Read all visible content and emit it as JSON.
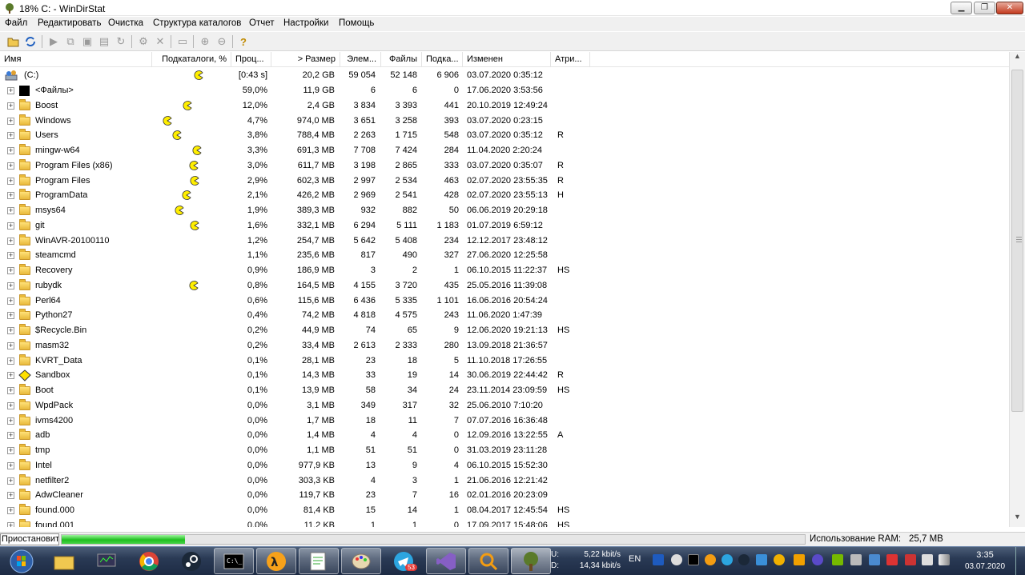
{
  "window": {
    "title": "18% C: - WinDirStat",
    "minimize_icon": "minimize-icon",
    "restore_icon": "restore-icon",
    "close_icon": "close-icon"
  },
  "menu": [
    "Файл",
    "Редактировать",
    "Очистка",
    "Структура каталогов",
    "Отчет",
    "Настройки",
    "Помощь"
  ],
  "toolbar": [
    "open-icon",
    "refresh-icon",
    "play-icon",
    "copy-icon",
    "explorer-icon",
    "cmd-icon",
    "refresh-selected-icon",
    "clean-icon",
    "delete-icon",
    "new-folder-icon",
    "zoom-in-icon",
    "zoom-out-icon",
    "help-icon"
  ],
  "columns": [
    "Имя",
    "Подкаталоги, %",
    "Проц...",
    "> Размер",
    "Элем...",
    "Файлы",
    "Подка...",
    "Изменен",
    "Атри..."
  ],
  "root": {
    "name": "(C:)",
    "percent": "[0:43 s]",
    "size": "20,2 GB",
    "items": "59 054",
    "files": "52 148",
    "subdirs": "6 906",
    "modified": "03.07.2020 0:35:12",
    "attr": ""
  },
  "rows": [
    {
      "name": "<Файлы>",
      "percent": "59,0%",
      "size": "11,9 GB",
      "items": "6",
      "files": "6",
      "subdirs": "0",
      "modified": "17.06.2020 3:53:56",
      "attr": ""
    },
    {
      "name": "Boost",
      "percent": "12,0%",
      "size": "2,4 GB",
      "items": "3 834",
      "files": "3 393",
      "subdirs": "441",
      "modified": "20.10.2019 12:49:24",
      "attr": ""
    },
    {
      "name": "Windows",
      "percent": "4,7%",
      "size": "974,0 MB",
      "items": "3 651",
      "files": "3 258",
      "subdirs": "393",
      "modified": "03.07.2020 0:23:15",
      "attr": ""
    },
    {
      "name": "Users",
      "percent": "3,8%",
      "size": "788,4 MB",
      "items": "2 263",
      "files": "1 715",
      "subdirs": "548",
      "modified": "03.07.2020 0:35:12",
      "attr": "R"
    },
    {
      "name": "mingw-w64",
      "percent": "3,3%",
      "size": "691,3 MB",
      "items": "7 708",
      "files": "7 424",
      "subdirs": "284",
      "modified": "11.04.2020 2:20:24",
      "attr": ""
    },
    {
      "name": "Program Files (x86)",
      "percent": "3,0%",
      "size": "611,7 MB",
      "items": "3 198",
      "files": "2 865",
      "subdirs": "333",
      "modified": "03.07.2020 0:35:07",
      "attr": "R"
    },
    {
      "name": "Program Files",
      "percent": "2,9%",
      "size": "602,3 MB",
      "items": "2 997",
      "files": "2 534",
      "subdirs": "463",
      "modified": "02.07.2020 23:55:35",
      "attr": "R"
    },
    {
      "name": "ProgramData",
      "percent": "2,1%",
      "size": "426,2 MB",
      "items": "2 969",
      "files": "2 541",
      "subdirs": "428",
      "modified": "02.07.2020 23:55:13",
      "attr": "H"
    },
    {
      "name": "msys64",
      "percent": "1,9%",
      "size": "389,3 MB",
      "items": "932",
      "files": "882",
      "subdirs": "50",
      "modified": "06.06.2019 20:29:18",
      "attr": ""
    },
    {
      "name": "git",
      "percent": "1,6%",
      "size": "332,1 MB",
      "items": "6 294",
      "files": "5 111",
      "subdirs": "1 183",
      "modified": "01.07.2019 6:59:12",
      "attr": ""
    },
    {
      "name": "WinAVR-20100110",
      "percent": "1,2%",
      "size": "254,7 MB",
      "items": "5 642",
      "files": "5 408",
      "subdirs": "234",
      "modified": "12.12.2017 23:48:12",
      "attr": ""
    },
    {
      "name": "steamcmd",
      "percent": "1,1%",
      "size": "235,6 MB",
      "items": "817",
      "files": "490",
      "subdirs": "327",
      "modified": "27.06.2020 12:25:58",
      "attr": ""
    },
    {
      "name": "Recovery",
      "percent": "0,9%",
      "size": "186,9 MB",
      "items": "3",
      "files": "2",
      "subdirs": "1",
      "modified": "06.10.2015 11:22:37",
      "attr": "HS"
    },
    {
      "name": "rubydk",
      "percent": "0,8%",
      "size": "164,5 MB",
      "items": "4 155",
      "files": "3 720",
      "subdirs": "435",
      "modified": "25.05.2016 11:39:08",
      "attr": ""
    },
    {
      "name": "Perl64",
      "percent": "0,6%",
      "size": "115,6 MB",
      "items": "6 436",
      "files": "5 335",
      "subdirs": "1 101",
      "modified": "16.06.2016 20:54:24",
      "attr": ""
    },
    {
      "name": "Python27",
      "percent": "0,4%",
      "size": "74,2 MB",
      "items": "4 818",
      "files": "4 575",
      "subdirs": "243",
      "modified": "11.06.2020 1:47:39",
      "attr": ""
    },
    {
      "name": "$Recycle.Bin",
      "percent": "0,2%",
      "size": "44,9 MB",
      "items": "74",
      "files": "65",
      "subdirs": "9",
      "modified": "12.06.2020 19:21:13",
      "attr": "HS"
    },
    {
      "name": "masm32",
      "percent": "0,2%",
      "size": "33,4 MB",
      "items": "2 613",
      "files": "2 333",
      "subdirs": "280",
      "modified": "13.09.2018 21:36:57",
      "attr": ""
    },
    {
      "name": "KVRT_Data",
      "percent": "0,1%",
      "size": "28,1 MB",
      "items": "23",
      "files": "18",
      "subdirs": "5",
      "modified": "11.10.2018 17:26:55",
      "attr": ""
    },
    {
      "name": "Sandbox",
      "percent": "0,1%",
      "size": "14,3 MB",
      "items": "33",
      "files": "19",
      "subdirs": "14",
      "modified": "30.06.2019 22:44:42",
      "attr": "R"
    },
    {
      "name": "Boot",
      "percent": "0,1%",
      "size": "13,9 MB",
      "items": "58",
      "files": "34",
      "subdirs": "24",
      "modified": "23.11.2014 23:09:59",
      "attr": "HS"
    },
    {
      "name": "WpdPack",
      "percent": "0,0%",
      "size": "3,1 MB",
      "items": "349",
      "files": "317",
      "subdirs": "32",
      "modified": "25.06.2010 7:10:20",
      "attr": ""
    },
    {
      "name": "ivms4200",
      "percent": "0,0%",
      "size": "1,7 MB",
      "items": "18",
      "files": "11",
      "subdirs": "7",
      "modified": "07.07.2016 16:36:48",
      "attr": ""
    },
    {
      "name": "adb",
      "percent": "0,0%",
      "size": "1,4 MB",
      "items": "4",
      "files": "4",
      "subdirs": "0",
      "modified": "12.09.2016 13:22:55",
      "attr": "A"
    },
    {
      "name": "tmp",
      "percent": "0,0%",
      "size": "1,1 MB",
      "items": "51",
      "files": "51",
      "subdirs": "0",
      "modified": "31.03.2019 23:11:28",
      "attr": ""
    },
    {
      "name": "Intel",
      "percent": "0,0%",
      "size": "977,9 KB",
      "items": "13",
      "files": "9",
      "subdirs": "4",
      "modified": "06.10.2015 15:52:30",
      "attr": ""
    },
    {
      "name": "netfilter2",
      "percent": "0,0%",
      "size": "303,3 KB",
      "items": "4",
      "files": "3",
      "subdirs": "1",
      "modified": "21.06.2016 12:21:42",
      "attr": ""
    },
    {
      "name": "AdwCleaner",
      "percent": "0,0%",
      "size": "119,7 KB",
      "items": "23",
      "files": "7",
      "subdirs": "16",
      "modified": "02.01.2016 20:23:09",
      "attr": ""
    },
    {
      "name": "found.000",
      "percent": "0,0%",
      "size": "81,4 KB",
      "items": "15",
      "files": "14",
      "subdirs": "1",
      "modified": "08.04.2017 12:45:54",
      "attr": "HS"
    },
    {
      "name": "found.001",
      "percent": "0,0%",
      "size": "11,2 KB",
      "items": "1",
      "files": "1",
      "subdirs": "0",
      "modified": "17.09.2017 15:48:06",
      "attr": "HS"
    }
  ],
  "status": {
    "text": "Приостановит",
    "progress_fraction": 0.18,
    "ram_label": "Использование RAM:",
    "ram_value": "25,7 MB"
  },
  "taskbar": {
    "apps": [
      "start-orb",
      "explorer",
      "monitor",
      "chrome",
      "steam",
      "console",
      "half-life-2",
      "notepad-plus",
      "paint",
      "telegram",
      "visual-studio",
      "search-tool",
      "windirstat"
    ],
    "telegram_badge": "53",
    "net_u_label": "U:",
    "net_u": "5,22 kbit/s",
    "net_d_label": "D:",
    "net_d": "14,34 kbit/s",
    "lang": "EN",
    "time": "3:35",
    "date": "03.07.2020"
  },
  "colors": {
    "accent_progress": "#1fbf1f",
    "pacman": "#ffee00",
    "folder": "#f0c850"
  }
}
